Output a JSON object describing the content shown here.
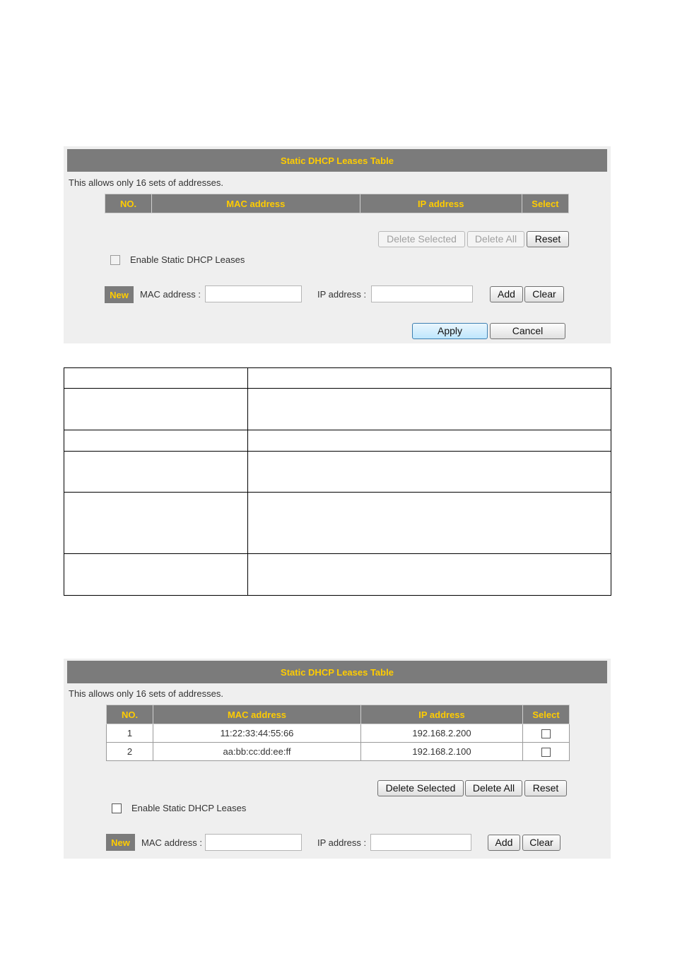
{
  "panel1": {
    "title": "Static DHCP Leases Table",
    "note": "This allows only 16 sets of addresses.",
    "columns": [
      "NO.",
      "MAC address",
      "IP address",
      "Select"
    ],
    "buttons": {
      "delete_selected": "Delete Selected",
      "delete_all": "Delete All",
      "reset": "Reset"
    },
    "enable_label": "Enable Static DHCP Leases",
    "enabled": false,
    "new_badge": "New",
    "mac_label": "MAC address :",
    "mac_value": "",
    "ip_label": "IP address :",
    "ip_value": "",
    "add": "Add",
    "clear": "Clear",
    "apply": "Apply",
    "cancel": "Cancel"
  },
  "panel2": {
    "title": "Static DHCP Leases Table",
    "note": "This allows only 16 sets of addresses.",
    "columns": [
      "NO.",
      "MAC address",
      "IP address",
      "Select"
    ],
    "rows": [
      {
        "no": "1",
        "mac": "11:22:33:44:55:66",
        "ip": "192.168.2.200",
        "selected": false
      },
      {
        "no": "2",
        "mac": "aa:bb:cc:dd:ee:ff",
        "ip": "192.168.2.100",
        "selected": false
      }
    ],
    "buttons": {
      "delete_selected": "Delete Selected",
      "delete_all": "Delete All",
      "reset": "Reset"
    },
    "enable_label": "Enable Static DHCP Leases",
    "enabled": false,
    "new_badge": "New",
    "mac_label": "MAC address :",
    "mac_value": "",
    "ip_label": "IP address :",
    "ip_value": "",
    "add": "Add",
    "clear": "Clear"
  },
  "colors": {
    "title_bar_bg": "#7b7b7b",
    "title_text": "#ffcc00",
    "panel_bg": "#efefef"
  }
}
